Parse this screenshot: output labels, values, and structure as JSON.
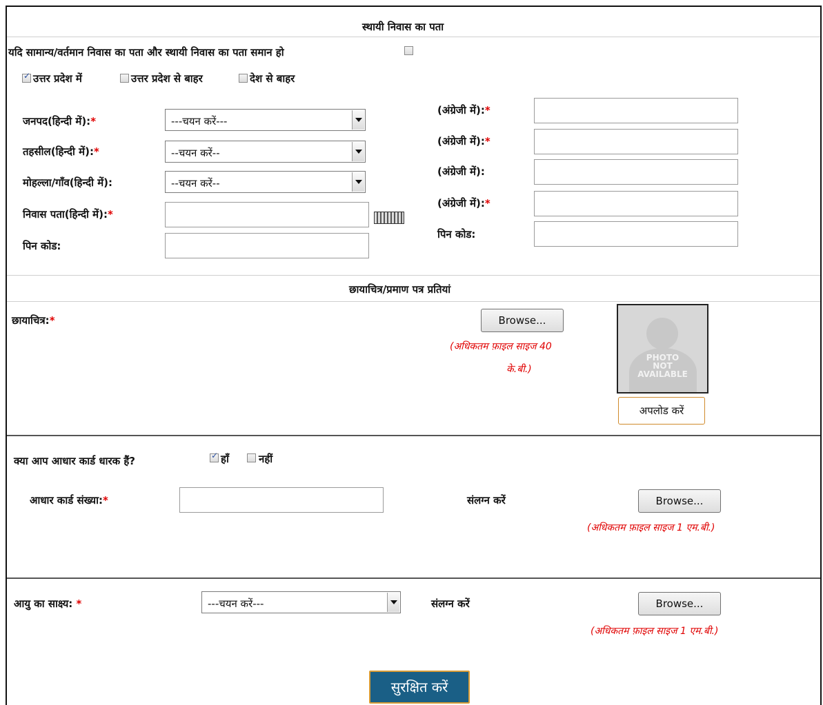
{
  "permanent_address": {
    "title": "स्थायी निवास का पता",
    "same_as_current_label": "यदि सामान्य/वर्तमान निवास का पता और स्थायी निवास का पता समान हो",
    "location_options": [
      "उत्तर प्रदेश में",
      "उत्तर प्रदेश से बाहर",
      "देश से बाहर"
    ],
    "location_checked": "उत्तर प्रदेश में",
    "fields_hindi": {
      "district_label": "जनपद(हिन्दी में):",
      "district_value": "---चयन करें---",
      "tehsil_label": "तहसील(हिन्दी में):",
      "tehsil_value": "--चयन करें--",
      "village_label": "मोहल्ला/गाँव(हिन्दी में):",
      "village_value": "--चयन करें--",
      "address_label": "निवास पता(हिन्दी में):",
      "pincode_label": "पिन कोड:"
    },
    "fields_english": {
      "english_label": "(अंग्रेजी में):",
      "pincode_label": "पिन कोड:"
    },
    "required_mark": "*"
  },
  "documents": {
    "title": "छायाचित्र/प्रमाण पत्र प्रतियां",
    "photo_label": "छायाचित्र:",
    "browse_label": "Browse...",
    "photo_size_hint_line1": "(अधिकतम फ़ाइल साइज 40",
    "photo_size_hint_line2": "के.बी.)",
    "photo_placeholder": [
      "PHOTO",
      "NOT",
      "AVAILABLE"
    ],
    "upload_label": "अपलोड करें"
  },
  "aadhaar": {
    "question": "क्या आप आधार कार्ड धारक हैं?",
    "yes_label": "हाँ",
    "no_label": "नहीं",
    "number_label": "आधार कार्ड संख्या:",
    "attach_label": "संलग्न करें",
    "browse_label": "Browse...",
    "size_hint": "(अधिकतम फ़ाइल साइज 1 एम.बी.)"
  },
  "age_proof": {
    "label": "आयु का साक्ष्य:",
    "select_value": "---चयन करें---",
    "attach_label": "संलग्न करें",
    "browse_label": "Browse...",
    "size_hint": "(अधिकतम फ़ाइल साइज 1 एम.बी.)"
  },
  "save_label": "सुरक्षित करें",
  "colors": {
    "required": "#e00000",
    "save_button_bg": "#1a5f86",
    "save_button_border": "#d99c35",
    "upload_border": "#d08a2a"
  }
}
